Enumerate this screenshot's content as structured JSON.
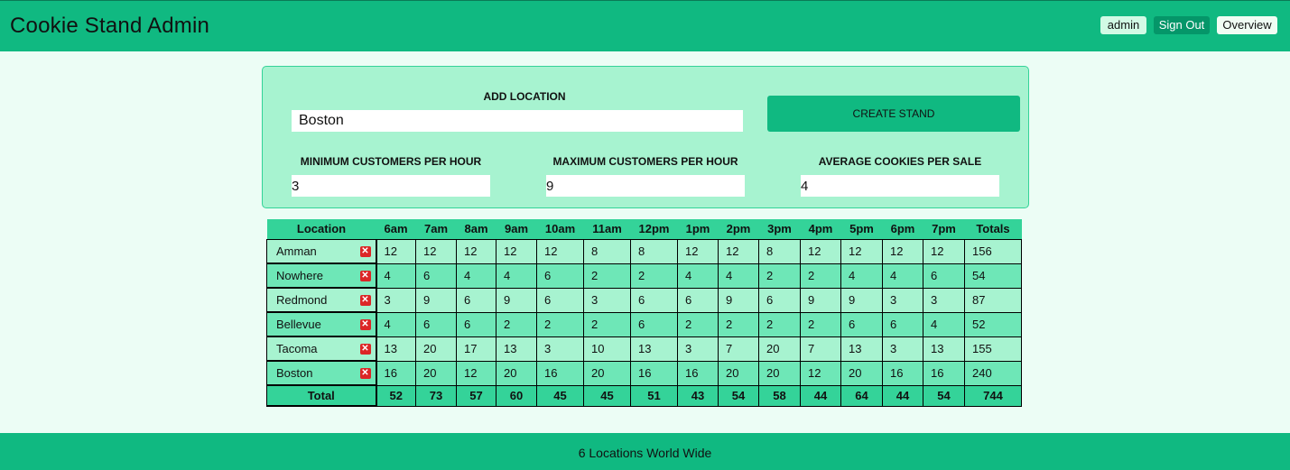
{
  "header": {
    "title": "Cookie Stand Admin",
    "user_label": "admin",
    "signout_label": "Sign Out",
    "overview_label": "Overview"
  },
  "form": {
    "location_label": "ADD LOCATION",
    "location_value": "Boston",
    "create_label": "CREATE STAND",
    "min_label": "MINIMUM CUSTOMERS PER HOUR",
    "min_value": "3",
    "max_label": "MAXIMUM CUSTOMERS PER HOUR",
    "max_value": "9",
    "avg_label": "AVERAGE COOKIES PER SALE",
    "avg_value": "4"
  },
  "table": {
    "headers": [
      "Location",
      "6am",
      "7am",
      "8am",
      "9am",
      "10am",
      "11am",
      "12pm",
      "1pm",
      "2pm",
      "3pm",
      "4pm",
      "5pm",
      "6pm",
      "7pm",
      "Totals"
    ],
    "rows": [
      {
        "location": "Amman",
        "values": [
          "12",
          "12",
          "12",
          "12",
          "12",
          "8",
          "8",
          "12",
          "12",
          "8",
          "12",
          "12",
          "12",
          "12"
        ],
        "total": "156"
      },
      {
        "location": "Nowhere",
        "values": [
          "4",
          "6",
          "4",
          "4",
          "6",
          "2",
          "2",
          "4",
          "4",
          "2",
          "2",
          "4",
          "4",
          "6"
        ],
        "total": "54"
      },
      {
        "location": "Redmond",
        "values": [
          "3",
          "9",
          "6",
          "9",
          "6",
          "3",
          "6",
          "6",
          "9",
          "6",
          "9",
          "9",
          "3",
          "3"
        ],
        "total": "87"
      },
      {
        "location": "Bellevue",
        "values": [
          "4",
          "6",
          "6",
          "2",
          "2",
          "2",
          "6",
          "2",
          "2",
          "2",
          "2",
          "6",
          "6",
          "4"
        ],
        "total": "52"
      },
      {
        "location": "Tacoma",
        "values": [
          "13",
          "20",
          "17",
          "13",
          "3",
          "10",
          "13",
          "3",
          "7",
          "20",
          "7",
          "13",
          "3",
          "13"
        ],
        "total": "155"
      },
      {
        "location": "Boston",
        "values": [
          "16",
          "20",
          "12",
          "20",
          "16",
          "20",
          "16",
          "16",
          "20",
          "20",
          "12",
          "20",
          "16",
          "16"
        ],
        "total": "240"
      }
    ],
    "totals_label": "Total",
    "totals": [
      "52",
      "73",
      "57",
      "60",
      "45",
      "45",
      "51",
      "43",
      "54",
      "58",
      "44",
      "64",
      "44",
      "54"
    ],
    "grand_total": "744",
    "delete_icon": "✕"
  },
  "footer": {
    "text": "6 Locations World Wide"
  }
}
